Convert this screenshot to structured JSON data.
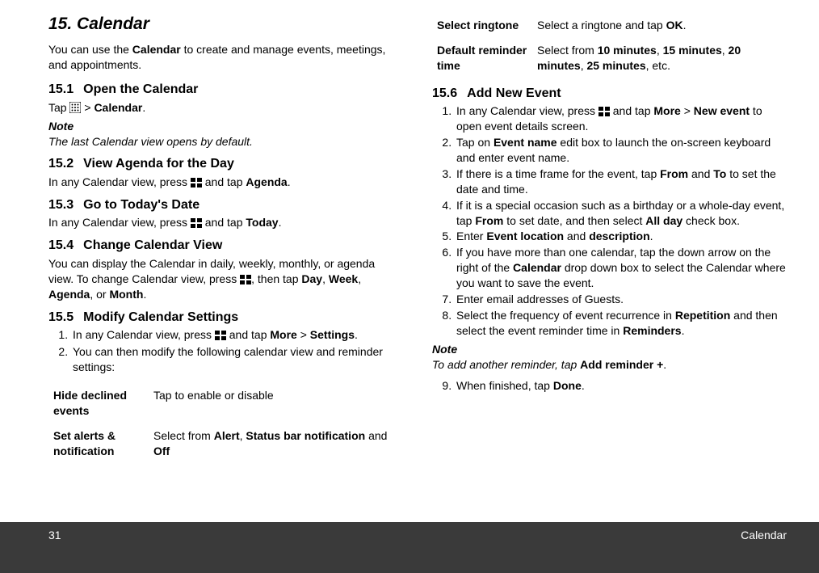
{
  "chapter": {
    "num": "15.",
    "title": "Calendar"
  },
  "intro": {
    "pre": "You can use the ",
    "b1": "Calendar",
    "post": " to create and manage events, meetings, and appointments."
  },
  "s1": {
    "num": "15.1",
    "title": "Open the Calendar",
    "tap": "Tap ",
    "gt": " > ",
    "b1": "Calendar",
    "dot": ".",
    "noteLabel": "Note",
    "noteBody": "The last Calendar view opens by default."
  },
  "s2": {
    "num": "15.2",
    "title": "View Agenda for the Day",
    "pre": "In any Calendar view, press ",
    "post": " and tap ",
    "b1": "Agenda",
    "dot": "."
  },
  "s3": {
    "num": "15.3",
    "title": "Go to Today's Date",
    "pre": "In any Calendar view, press ",
    "post": " and tap ",
    "b1": "Today",
    "dot": "."
  },
  "s4": {
    "num": "15.4",
    "title": "Change Calendar View",
    "text1": "You can display the Calendar in daily, weekly, monthly, or agenda view. To change Calendar view, press ",
    "text2": ", then tap ",
    "b1": "Day",
    "c": ", ",
    "b2": "Week",
    "b3": "Agenda",
    "or": ", or ",
    "b4": "Month",
    "dot": "."
  },
  "s5": {
    "num": "15.5",
    "title": "Modify Calendar Settings",
    "li1": {
      "pre": "In any Calendar view, press ",
      "post": " and tap ",
      "b1": "More",
      "gt": " > ",
      "b2": "Settings",
      "dot": "."
    },
    "li2": "You can then modify the following calendar view and reminder settings:",
    "rows": [
      {
        "label": "Hide declined events",
        "desc": {
          "t": "Tap to enable or disable"
        }
      },
      {
        "label": "Set alerts & notification",
        "desc": {
          "pre": "Select from ",
          "b1": "Alert",
          "c": ", ",
          "b2": "Status bar notification",
          "and": " and ",
          "b3": "Off"
        }
      },
      {
        "label": "Select ringtone",
        "desc": {
          "pre": "Select a ringtone and tap ",
          "b1": "OK",
          "dot": "."
        }
      },
      {
        "label": "Default reminder time",
        "desc": {
          "pre": "Select from ",
          "b1": "10 minutes",
          "c": ", ",
          "b2": "15 minutes",
          "b3": "20 minutes",
          "b4": "25 minutes",
          "etc": ", etc."
        }
      }
    ]
  },
  "s6": {
    "num": "15.6",
    "title": "Add New Event",
    "li1": {
      "pre": "In any Calendar view, press ",
      "post": " and tap ",
      "b1": "More",
      "gt": " > ",
      "b2": "New event",
      "tail": " to open event details screen."
    },
    "li2": {
      "pre": "Tap on ",
      "b1": "Event name",
      "tail": " edit box to launch the on-screen keyboard and enter event name."
    },
    "li3": {
      "pre": "If there is a time frame for the event, tap ",
      "b1": "From",
      "and": " and ",
      "b2": "To",
      "tail": " to set the date and time."
    },
    "li4": {
      "pre": "If it is a special occasion such as a birthday or a whole-day event, tap ",
      "b1": "From",
      "mid": " to set date, and then select ",
      "b2": "All day",
      "tail": " check box."
    },
    "li5": {
      "pre": "Enter ",
      "b1": "Event location",
      "and": " and ",
      "b2": "description",
      "dot": "."
    },
    "li6": {
      "pre": "If you have more than one calendar, tap the down arrow on the right of the ",
      "b1": "Calendar",
      "tail": " drop down box to select the Calendar where you want to save the event."
    },
    "li7": "Enter email addresses of Guests.",
    "li8": {
      "pre": "Select the frequency of event recurrence in ",
      "b1": "Repetition",
      "mid": " and then select the event reminder time in ",
      "b2": "Reminders",
      "dot": "."
    },
    "noteLabel": "Note",
    "noteBody": {
      "pre": "To add another reminder, tap ",
      "b1": "Add reminder +",
      "dot": "."
    },
    "li9": {
      "pre": "When finished, tap ",
      "b1": "Done",
      "dot": "."
    }
  },
  "footer": {
    "page": "31",
    "section": "Calendar"
  }
}
